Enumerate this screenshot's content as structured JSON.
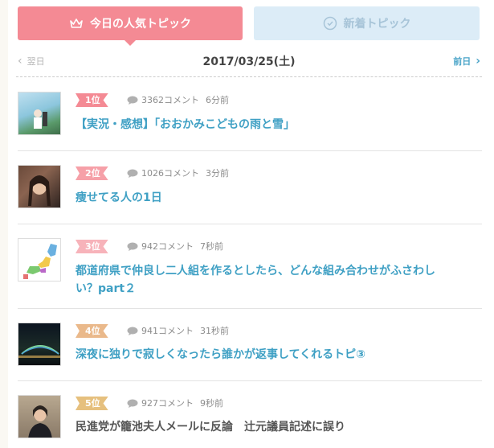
{
  "tabs": {
    "active_label": "今日の人気トピック",
    "inactive_label": "新着トピック"
  },
  "datenav": {
    "prev_label": "翌日",
    "date": "2017/03/25(土)",
    "next_label": "前日"
  },
  "topics": [
    {
      "rank": "1位",
      "comments": "3362コメント",
      "time": "6分前",
      "title": "【実況・感想】「おおかみこどもの雨と雪」",
      "rank_color": "#f48a94"
    },
    {
      "rank": "2位",
      "comments": "1026コメント",
      "time": "3分前",
      "title": "痩せてる人の1日",
      "rank_color": "#f6a0a8"
    },
    {
      "rank": "3位",
      "comments": "942コメント",
      "time": "7秒前",
      "title": "都道府県で仲良し二人組を作るとしたら、どんな組み合わせがふさわしい？part２",
      "rank_color": "#f7b3ba"
    },
    {
      "rank": "4位",
      "comments": "941コメント",
      "time": "31秒前",
      "title": "深夜に独りで寂しくなったら誰かが返事してくれるトピ③",
      "rank_color": "#eab98b"
    },
    {
      "rank": "5位",
      "comments": "927コメント",
      "time": "9秒前",
      "title": "民進党が籠池夫人メールに反論　辻元議員記述に誤り",
      "rank_color": "#e6c07e"
    }
  ],
  "colors": {
    "accent_pink": "#f48a94",
    "inactive_tab": "#dcecf7",
    "title_blue": "#3fa0c4"
  },
  "icons": {
    "active_tab": "crown-icon",
    "inactive_tab": "clock-icon",
    "comment": "comment-bubble-icon"
  }
}
